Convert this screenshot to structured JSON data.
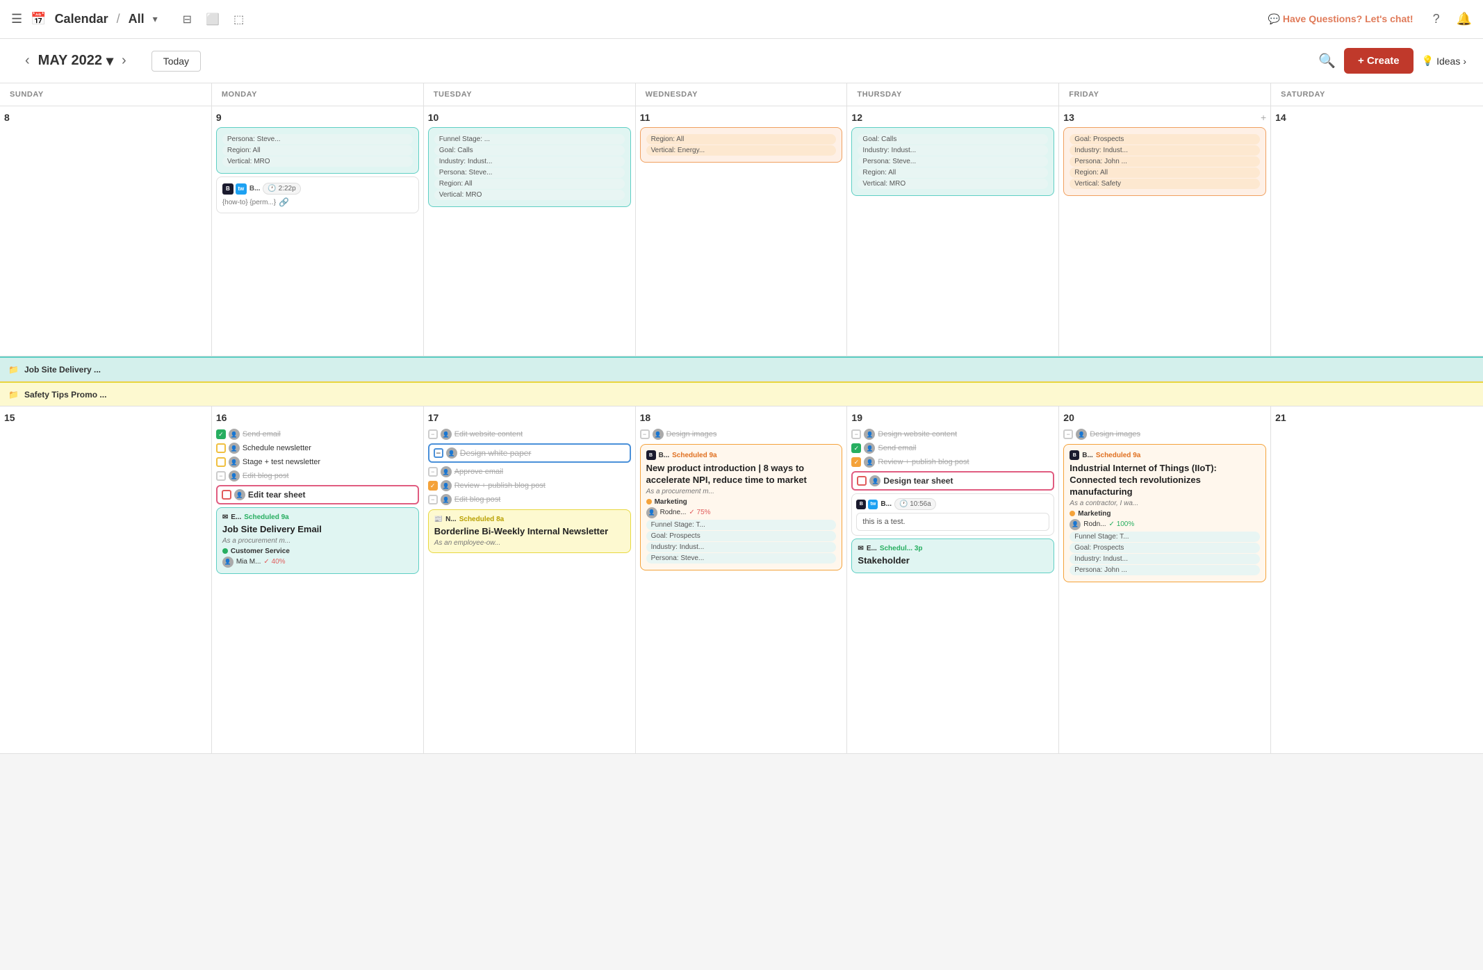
{
  "topNav": {
    "hamburger": "☰",
    "calendarIcon": "📅",
    "title": "Calendar",
    "separator": "/",
    "viewAll": "All",
    "chevron": "▾",
    "filterIcon": "⊟",
    "monitorIcon": "⬜",
    "shareIcon": "⬚",
    "chatText": "💬 Have Questions? Let's chat!",
    "questionMark": "?",
    "bellIcon": "🔔"
  },
  "calToolbar": {
    "prevBtn": "‹",
    "nextBtn": "›",
    "monthLabel": "MAY 2022",
    "monthChevron": "▾",
    "todayBtn": "Today",
    "searchIcon": "🔍",
    "createBtn": "+ Create",
    "ideasBtn": "Ideas",
    "ideasChevron": "›"
  },
  "daysOfWeek": [
    "SUNDAY",
    "MONDAY",
    "TUESDAY",
    "WEDNESDAY",
    "THURSDAY",
    "FRIDAY",
    "SATURDAY"
  ],
  "week1": {
    "days": [
      {
        "num": "8",
        "events": []
      },
      {
        "num": "9",
        "events": [
          {
            "type": "chip-teal",
            "text": "Persona: Steve..."
          },
          {
            "type": "chip-teal",
            "text": "Region: All"
          },
          {
            "type": "chip-teal",
            "text": "Vertical: MRO"
          },
          {
            "type": "social-post",
            "time": "2:22p",
            "caption": "{how-to} {perm...}"
          }
        ]
      },
      {
        "num": "10",
        "events": [
          {
            "type": "chip-teal",
            "text": "Funnel Stage: ..."
          },
          {
            "type": "chip-teal",
            "text": "Goal: Calls"
          },
          {
            "type": "chip-teal",
            "text": "Industry: Indust..."
          },
          {
            "type": "chip-teal",
            "text": "Persona: Steve..."
          },
          {
            "type": "chip-teal",
            "text": "Region: All"
          },
          {
            "type": "chip-teal",
            "text": "Vertical: MRO"
          }
        ]
      },
      {
        "num": "11",
        "events": [
          {
            "type": "chip-orange",
            "text": "Region: All"
          },
          {
            "type": "chip-orange",
            "text": "Vertical: Energy..."
          }
        ]
      },
      {
        "num": "12",
        "events": [
          {
            "type": "chip-teal",
            "text": "Goal: Calls"
          },
          {
            "type": "chip-teal",
            "text": "Industry: Indust..."
          },
          {
            "type": "chip-teal",
            "text": "Persona: Steve..."
          },
          {
            "type": "chip-teal",
            "text": "Region: All"
          },
          {
            "type": "chip-teal",
            "text": "Vertical: MRO"
          }
        ]
      },
      {
        "num": "13",
        "addPlus": true,
        "events": [
          {
            "type": "chip-orange",
            "text": "Goal: Prospects"
          },
          {
            "type": "chip-orange",
            "text": "Industry: Indust..."
          },
          {
            "type": "chip-orange",
            "text": "Persona: John ..."
          },
          {
            "type": "chip-orange",
            "text": "Region: All"
          },
          {
            "type": "chip-orange",
            "text": "Vertical: Safety"
          }
        ]
      },
      {
        "num": "14",
        "events": []
      }
    ]
  },
  "banners": [
    {
      "color": "teal",
      "text": "Job Site Delivery ..."
    },
    {
      "color": "yellow",
      "text": "Safety Tips Promo ..."
    }
  ],
  "week2": {
    "days": [
      {
        "num": "15",
        "events": []
      },
      {
        "num": "16",
        "events": [
          {
            "type": "check-done",
            "text": "Send email"
          },
          {
            "type": "check-yellow",
            "text": "Schedule newsletter"
          },
          {
            "type": "check-yellow",
            "text": "Stage + test newsletter"
          },
          {
            "type": "check-minus",
            "text": "Edit blog post"
          },
          {
            "type": "check-pink",
            "text": "Edit tear sheet"
          },
          {
            "type": "scheduled-teal",
            "scheduledLabel": "E... Scheduled 9a",
            "title": "Job Site Delivery Email",
            "sub": "As a procurement m...",
            "dotColor": "green",
            "tag": "Customer Service",
            "avatar": "Mia M...",
            "progress": "40%"
          }
        ]
      },
      {
        "num": "17",
        "events": [
          {
            "type": "check-strikeblue",
            "text": "Edit website content"
          },
          {
            "type": "check-blue-selected",
            "text": "Design white paper"
          },
          {
            "type": "check-strikeblue",
            "text": "Approve email"
          },
          {
            "type": "check-done-orange",
            "text": "Review + publish blog post"
          },
          {
            "type": "check-minus-plain",
            "text": "Edit blog post"
          },
          {
            "type": "scheduled-yellow",
            "scheduledLabel": "N... Scheduled 8a",
            "title": "Borderline Bi-Weekly Internal Newsletter",
            "sub": "As an employee-ow..."
          }
        ]
      },
      {
        "num": "18",
        "events": [
          {
            "type": "check-strikeblue",
            "text": "Design images"
          },
          {
            "type": "scheduled-orange-fill",
            "scheduledLabel": "B... Scheduled 9a",
            "title": "New product introduction | 8 ways to accelerate NPI, reduce time to market",
            "sub": "As a procurement m...",
            "dotColor": "orange",
            "tag": "Marketing",
            "avatar": "Rodne...",
            "progress": "75%",
            "filters": [
              "Funnel Stage: T...",
              "Goal: Prospects",
              "Industry: Indust...",
              "Persona: Steve..."
            ]
          }
        ]
      },
      {
        "num": "19",
        "events": [
          {
            "type": "check-strikeblue",
            "text": "Design website content"
          },
          {
            "type": "check-done-green",
            "text": "Send email"
          },
          {
            "type": "check-orange-checked",
            "text": "Review + publish blog post"
          },
          {
            "type": "check-pink2",
            "text": "Design tear sheet"
          },
          {
            "type": "social-post2",
            "time": "10:56a",
            "note": "this is a test."
          },
          {
            "type": "scheduled-green-banner",
            "scheduledLabel": "E... Schedul... 3p",
            "title": "Stakeholder"
          }
        ]
      },
      {
        "num": "20",
        "events": [
          {
            "type": "check-strikeblue",
            "text": "Design images"
          },
          {
            "type": "scheduled-orange-fill2",
            "scheduledLabel": "B... Scheduled 9a",
            "title": "Industrial Internet of Things (IIoT): Connected tech revolutionizes manufacturing",
            "sub": "As a contractor, I wa...",
            "dotColor": "orange",
            "tag": "Marketing",
            "avatar": "Rodn...",
            "progress": "100%",
            "filters": [
              "Funnel Stage: T...",
              "Goal: Prospects",
              "Industry: Indust...",
              "Persona: John ..."
            ]
          }
        ]
      },
      {
        "num": "21",
        "events": []
      }
    ]
  }
}
